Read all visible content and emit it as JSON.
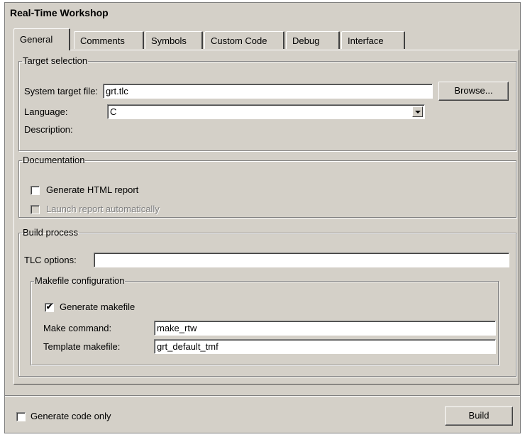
{
  "window": {
    "title": "Real-Time Workshop"
  },
  "tabs": [
    {
      "label": "General",
      "active": true
    },
    {
      "label": "Comments",
      "active": false
    },
    {
      "label": "Symbols",
      "active": false
    },
    {
      "label": "Custom Code",
      "active": false
    },
    {
      "label": "Debug",
      "active": false
    },
    {
      "label": "Interface",
      "active": false
    }
  ],
  "target_selection": {
    "legend": "Target selection",
    "system_target_label": "System target file:",
    "system_target_value": "grt.tlc",
    "browse_label": "Browse...",
    "language_label": "Language:",
    "language_value": "C",
    "description_label": "Description:"
  },
  "documentation": {
    "legend": "Documentation",
    "generate_html_label": "Generate HTML report",
    "generate_html_checked": false,
    "launch_report_label": "Launch report automatically",
    "launch_report_checked": false,
    "launch_report_enabled": false
  },
  "build_process": {
    "legend": "Build process",
    "tlc_options_label": "TLC options:",
    "tlc_options_value": "",
    "makefile": {
      "legend": "Makefile configuration",
      "generate_makefile_label": "Generate makefile",
      "generate_makefile_checked": true,
      "make_command_label": "Make command:",
      "make_command_value": "make_rtw",
      "template_makefile_label": "Template makefile:",
      "template_makefile_value": "grt_default_tmf"
    }
  },
  "footer": {
    "generate_code_only_label": "Generate code only",
    "generate_code_only_checked": false,
    "build_label": "Build"
  },
  "icons": {
    "checkmark": "✔",
    "dropdown": "chevron-down-icon"
  }
}
